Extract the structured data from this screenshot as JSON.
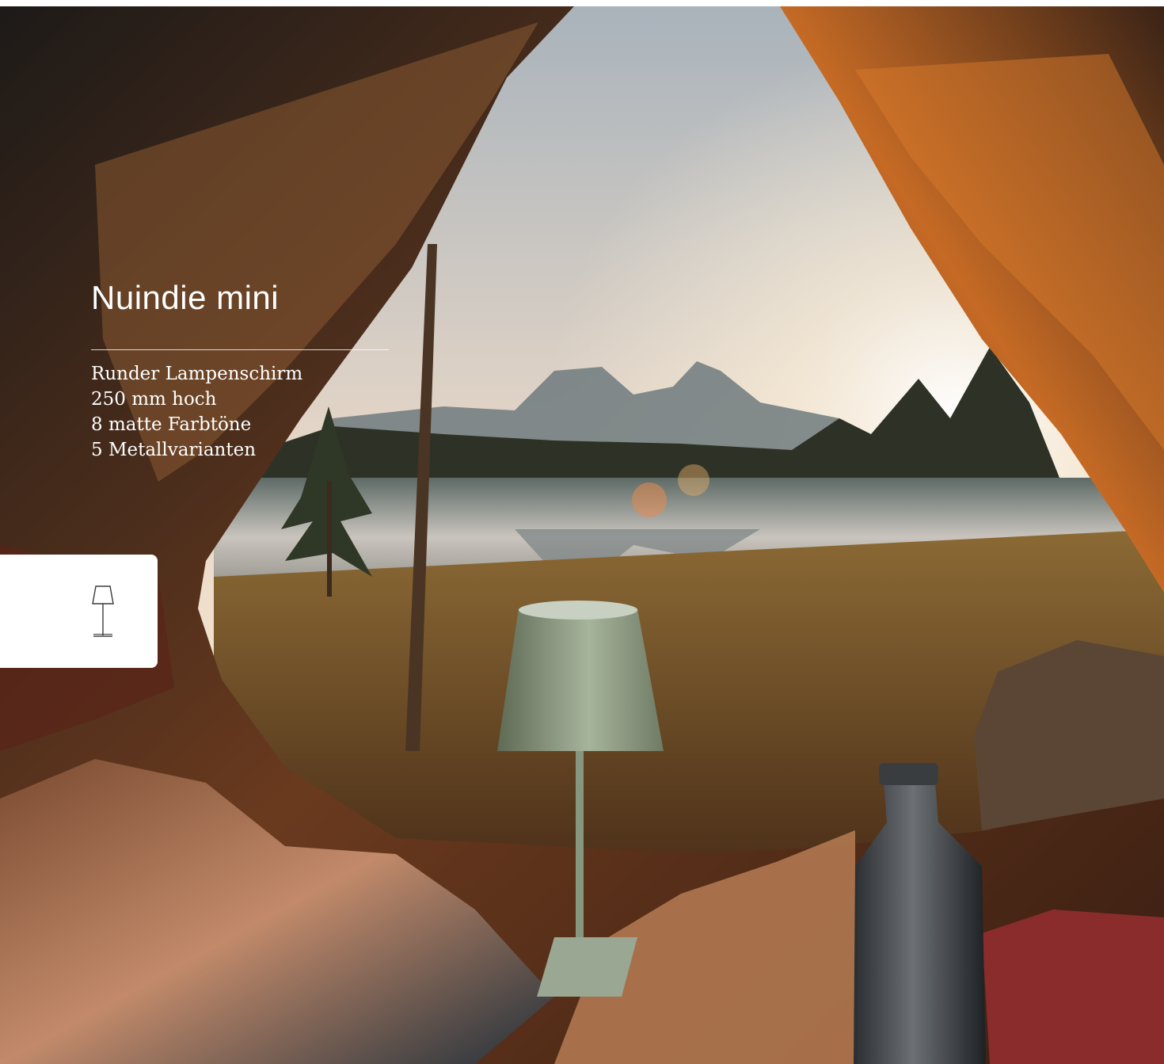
{
  "product": {
    "title": "Nuindie mini"
  },
  "specs": [
    "Runder Lampenschirm",
    "250 mm hoch",
    "8 matte Farbtöne",
    "5 Metallvarianten"
  ],
  "icon": {
    "name": "table-lamp-icon"
  },
  "colors": {
    "text": "#ffffff",
    "card": "#ffffff",
    "tent": "#b35a22",
    "sky": "#e8d7c4",
    "lamp": "#8a9a80"
  }
}
